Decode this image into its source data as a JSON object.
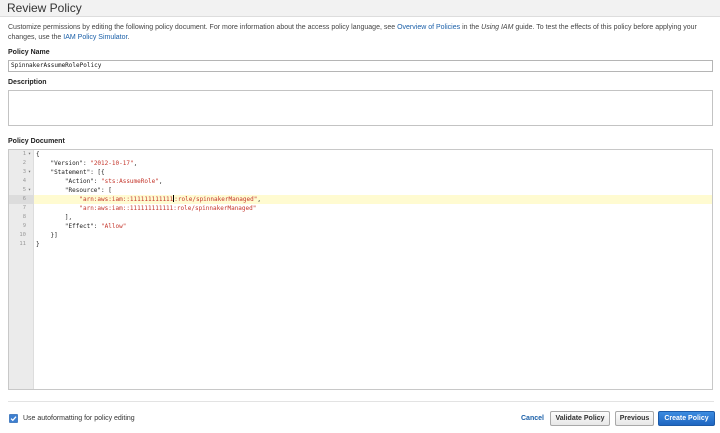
{
  "header": {
    "title": "Review Policy"
  },
  "intro": {
    "text_before": "Customize permissions by editing the following policy document. For more information about the access policy language, see ",
    "link_overview": "Overview of Policies",
    "text_middle": " in the ",
    "guide_italic": "Using IAM",
    "text_after": " guide. To test the effects of this policy before applying your changes, use the ",
    "link_simulator": "IAM Policy Simulator",
    "text_end": "."
  },
  "form": {
    "policy_name_label": "Policy Name",
    "policy_name_value": "SpinnakerAssumeRolePolicy",
    "description_label": "Description",
    "description_value": "",
    "policy_document_label": "Policy Document"
  },
  "editor": {
    "active_line": 6,
    "lines": [
      {
        "n": "1",
        "fold": true
      },
      {
        "n": "2"
      },
      {
        "n": "3",
        "fold": true
      },
      {
        "n": "4"
      },
      {
        "n": "5",
        "fold": true
      },
      {
        "n": "6"
      },
      {
        "n": "7"
      },
      {
        "n": "8"
      },
      {
        "n": "9"
      },
      {
        "n": "10"
      },
      {
        "n": "11"
      }
    ],
    "tokens": {
      "l1": "{",
      "l2_key": "\"Version\": ",
      "l2_val": "\"2012-10-17\"",
      "l2_end": ",",
      "l3": "\"Statement\": [{",
      "l4_key": "\"Action\": ",
      "l4_val": "\"sts:AssumeRole\"",
      "l4_end": ",",
      "l5": "\"Resource\": [",
      "l6_val_a": "\"arn:aws:iam::111111111111",
      "l6_val_b": ":role/spinnakerManaged\"",
      "l6_end": ",",
      "l7_val": "\"arn:aws:iam::111111111111:role/spinnakerManaged\"",
      "l8": "],",
      "l9_key": "\"Effect\": ",
      "l9_val": "\"Allow\"",
      "l10": "}]",
      "l11": "}"
    }
  },
  "footer": {
    "autoformat_label": "Use autoformatting for policy editing",
    "autoformat_checked": true,
    "cancel_label": "Cancel",
    "validate_label": "Validate Policy",
    "previous_label": "Previous",
    "create_label": "Create Policy"
  },
  "colors": {
    "link": "#1a5fa8",
    "primary_button": "#1f66c1",
    "string": "#c4352b",
    "active_line": "#fffbd1"
  }
}
